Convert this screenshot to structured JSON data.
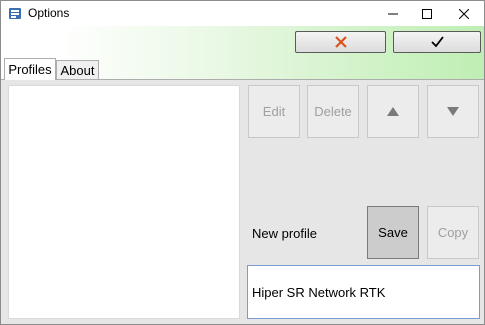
{
  "window": {
    "title": "Options",
    "controls": {
      "minimize": "minimize-icon",
      "maximize": "maximize-icon",
      "close": "close-icon"
    }
  },
  "toolbar": {
    "cancel_icon": "x-icon",
    "cancel_color": "#d9531e",
    "ok_icon": "check-icon"
  },
  "tabs": [
    {
      "label": "Profiles",
      "selected": true
    },
    {
      "label": "About",
      "selected": false
    }
  ],
  "profiles": {
    "items": [],
    "buttons": {
      "edit": "Edit",
      "delete": "Delete",
      "move_up": "up-triangle-icon",
      "move_down": "down-triangle-icon"
    },
    "new_profile_label": "New profile",
    "save": "Save",
    "copy": "Copy",
    "name_value": "Hiper SR Network RTK"
  },
  "colors": {
    "band_gradient_end": "#bfeeb3",
    "panel_bg": "#e6e6e6"
  }
}
